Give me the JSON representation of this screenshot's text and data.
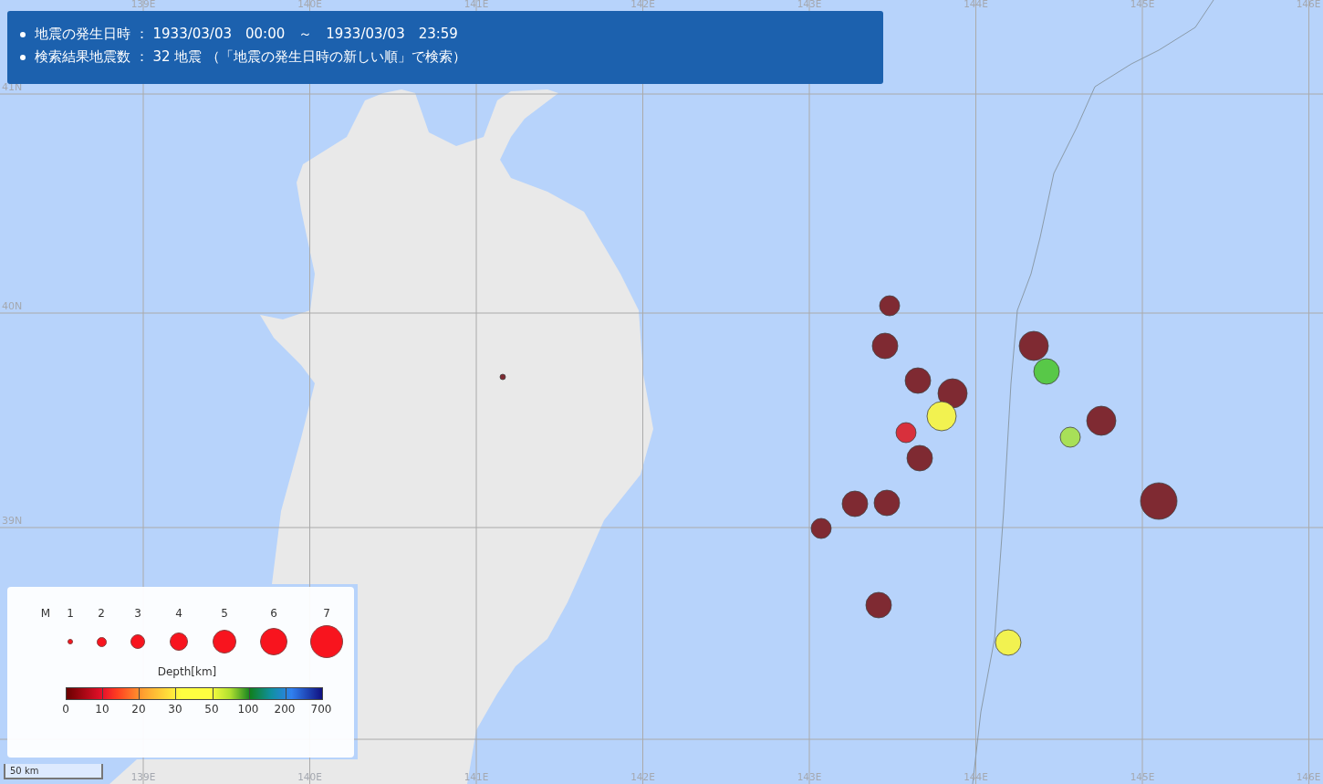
{
  "header": {
    "lines": [
      "地震の発生日時 ： 1933/03/03　00:00　～　1933/03/03　23:59",
      "検索結果地震数 ： 32 地震 （「地震の発生日時の新しい順」で検索）"
    ]
  },
  "grid": {
    "top_labels": [
      "139E",
      "140E",
      "141E",
      "142E",
      "143E",
      "144E",
      "145E",
      "146E"
    ],
    "bottom_labels": [
      "139E",
      "140E",
      "141E",
      "142E",
      "143E",
      "144E",
      "145E",
      "146E"
    ],
    "left_labels": [
      "41N",
      "40N",
      "39N"
    ]
  },
  "earthquakes": [
    {
      "kind": "m4",
      "color": "#7f2a32"
    },
    {
      "kind": "m5",
      "color": "#7f2a32"
    },
    {
      "kind": "m5",
      "color": "#7f2a32"
    },
    {
      "kind": "m6",
      "color": "#7f2a32"
    },
    {
      "kind": "m6",
      "color": "#f2f250"
    },
    {
      "kind": "m4",
      "color": "#d8303c"
    },
    {
      "kind": "m5",
      "color": "#7f2a32"
    },
    {
      "kind": "m5",
      "color": "#7f2a32"
    },
    {
      "kind": "m5",
      "color": "#7f2a32"
    },
    {
      "kind": "m4",
      "color": "#7f2a32"
    },
    {
      "kind": "m5",
      "color": "#7f2a32"
    },
    {
      "kind": "m5",
      "color": "#f2f250"
    },
    {
      "kind": "m6",
      "color": "#7f2a32"
    },
    {
      "kind": "m5",
      "color": "#58c848"
    },
    {
      "kind": "m4",
      "color": "#a8e058"
    },
    {
      "kind": "m6",
      "color": "#7f2a32"
    },
    {
      "kind": "m7",
      "color": "#7f2a32"
    },
    {
      "kind": "m1",
      "color": "#7f2a32"
    }
  ],
  "legend": {
    "magnitude_label": "M",
    "magnitudes": [
      {
        "label": "1",
        "kind": "m1"
      },
      {
        "label": "2",
        "kind": "m2"
      },
      {
        "label": "3",
        "kind": "m3"
      },
      {
        "label": "4",
        "kind": "m4"
      },
      {
        "label": "5",
        "kind": "m5"
      },
      {
        "label": "6",
        "kind": "m6"
      },
      {
        "label": "7",
        "kind": "m7"
      }
    ],
    "depth_title": "Depth[km]",
    "depth_ticks": [
      "0",
      "10",
      "20",
      "30",
      "50",
      "100",
      "200",
      "700"
    ]
  },
  "scale_bar": "50 km"
}
